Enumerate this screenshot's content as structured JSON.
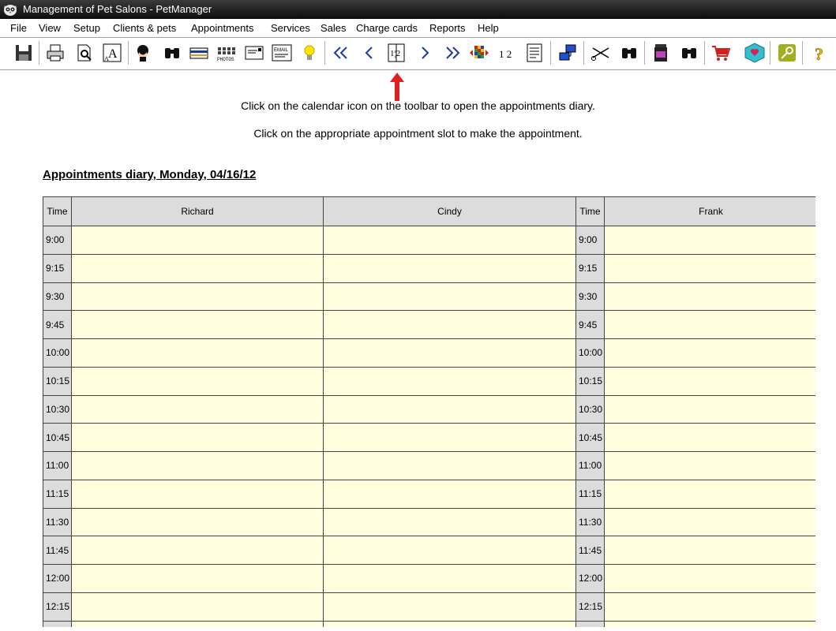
{
  "window": {
    "title": "Management of Pet Salons - PetManager"
  },
  "menu": [
    "File",
    "View",
    "Setup",
    "Clients & pets",
    "Appointments",
    "Services",
    "Sales",
    "Charge cards",
    "Reports",
    "Help"
  ],
  "toolbar": {
    "photos_label": "PHOTOS",
    "email_label": "EMAIL",
    "calendar_label": "1¦2",
    "numbers_label": "1 2",
    "icons": [
      "save-icon",
      "print-icon",
      "print-preview-icon",
      "font-icon",
      "client-head-icon",
      "binoculars-icon",
      "card-icon",
      "photos-icon",
      "letter-icon",
      "email-icon",
      "lightbulb-icon",
      "first-icon",
      "previous-icon",
      "calendar-icon",
      "next-icon",
      "last-icon",
      "color-grid-icon",
      "numbering-icon",
      "document-icon",
      "network-icon",
      "scissors-icon",
      "binoculars-icon",
      "bottles-icon",
      "binoculars-icon",
      "shopping-cart-icon",
      "heart-box-icon",
      "key-icon",
      "help-icon"
    ]
  },
  "instructions": {
    "line1": "Click on the calendar icon on the toolbar to open the appointments diary.",
    "line2": "Click on the appropriate appointment slot to make the appointment."
  },
  "diary": {
    "title": "Appointments diary, Monday, 04/16/12",
    "time_header": "Time",
    "staff": [
      "Richard",
      "Cindy",
      "Frank"
    ],
    "times": [
      "9:00",
      "9:15",
      "9:30",
      "9:45",
      "10:00",
      "10:15",
      "10:30",
      "10:45",
      "11:00",
      "11:15",
      "11:30",
      "11:45",
      "12:00",
      "12:15",
      ""
    ]
  },
  "colors": {
    "slot": "#ffffe0",
    "header": "#dcdcdc",
    "arrow": "#e02020",
    "titlebar": "#1a1a1a"
  }
}
